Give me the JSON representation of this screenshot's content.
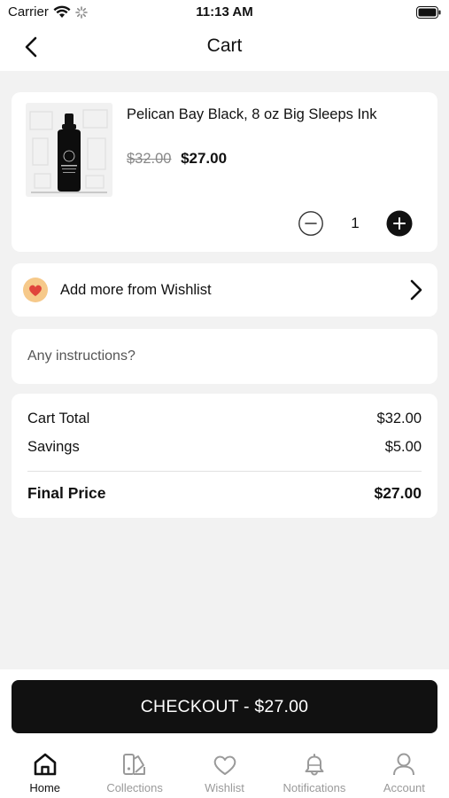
{
  "status": {
    "carrier": "Carrier",
    "time": "11:13 AM"
  },
  "nav": {
    "title": "Cart"
  },
  "cart_item": {
    "name": "Pelican Bay Black, 8 oz Big Sleeps Ink",
    "original_price": "$32.00",
    "price": "$27.00",
    "quantity": "1"
  },
  "wishlist": {
    "label": "Add more from Wishlist"
  },
  "instructions": {
    "placeholder": "Any instructions?"
  },
  "summary": {
    "cart_total_label": "Cart Total",
    "cart_total": "$32.00",
    "savings_label": "Savings",
    "savings": "$5.00",
    "final_label": "Final Price",
    "final": "$27.00"
  },
  "checkout": {
    "label": "CHECKOUT - $27.00"
  },
  "tabs": [
    {
      "label": "Home",
      "icon": "home-icon",
      "active": true
    },
    {
      "label": "Collections",
      "icon": "collections-icon",
      "active": false
    },
    {
      "label": "Wishlist",
      "icon": "heart-icon",
      "active": false
    },
    {
      "label": "Notifications",
      "icon": "bell-icon",
      "active": false
    },
    {
      "label": "Account",
      "icon": "user-icon",
      "active": false
    }
  ],
  "colors": {
    "background": "#f2f2f2",
    "card": "#ffffff",
    "primary": "#111111",
    "inactive_tab": "#9a9a9a",
    "wishlist_badge": "#f6c98a"
  }
}
